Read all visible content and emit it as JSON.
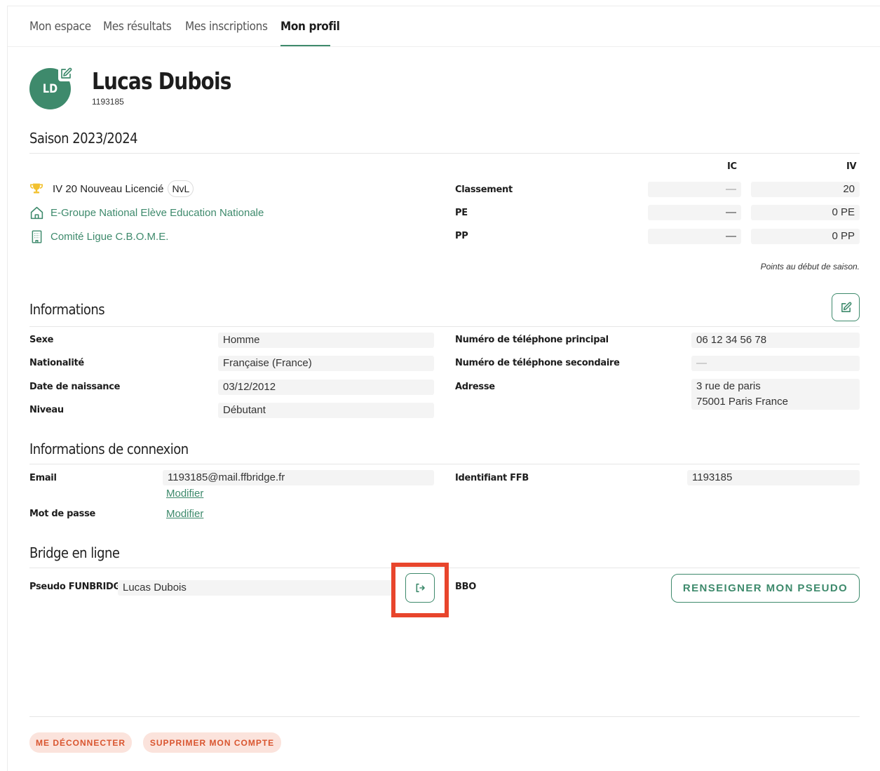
{
  "nav": {
    "tabs": [
      {
        "label": "Mon espace"
      },
      {
        "label": "Mes résultats"
      },
      {
        "label": "Mes inscriptions"
      },
      {
        "label": "Mon profil"
      }
    ]
  },
  "profile": {
    "initials": "LD",
    "name": "Lucas Dubois",
    "license_number": "1193185",
    "avatar_color": "#3e8a6c"
  },
  "season": {
    "title": "Saison 2023/2024",
    "rank_text": "IV 20 Nouveau Licencié",
    "rank_badge": "NvL",
    "group": "E-Groupe National Elève Education Nationale",
    "committee": "Comité Ligue C.B.O.M.E.",
    "columns": [
      "IC",
      "IV"
    ],
    "rows": [
      {
        "label": "Classement",
        "ic": "—",
        "iv": "20"
      },
      {
        "label": "PE",
        "ic": "—",
        "iv": "0 PE"
      },
      {
        "label": "PP",
        "ic": "—",
        "iv": "0 PP"
      }
    ],
    "note": "Points au début de saison."
  },
  "informations": {
    "title": "Informations",
    "left": [
      {
        "label": "Sexe",
        "value": "Homme"
      },
      {
        "label": "Nationalité",
        "value": "Française (France)"
      },
      {
        "label": "Date de naissance",
        "value": "03/12/2012"
      },
      {
        "label": "Niveau",
        "value": "Débutant"
      }
    ],
    "right": [
      {
        "label": "Numéro de téléphone principal",
        "value": "06 12 34 56 78"
      },
      {
        "label": "Numéro de téléphone secondaire",
        "value": "—"
      },
      {
        "label": "Adresse",
        "value_line1": "3 rue de paris",
        "value_line2": "75001 Paris France"
      }
    ]
  },
  "connexion": {
    "title": "Informations de connexion",
    "email_label": "Email",
    "email_value": "1193185@mail.ffbridge.fr",
    "email_modify": "Modifier",
    "password_label": "Mot de passe",
    "password_modify": "Modifier",
    "ffb_label": "Identifiant FFB",
    "ffb_value": "1193185"
  },
  "bridge": {
    "title": "Bridge en ligne",
    "funbridge_label": "Pseudo FUNBRIDGE",
    "funbridge_value": "Lucas Dubois",
    "bbo_label": "BBO",
    "bbo_button": "RENSEIGNER MON PSEUDO"
  },
  "footer": {
    "logout": "ME DÉCONNECTER",
    "delete": "SUPPRIMER MON COMPTE"
  },
  "colors": {
    "accent": "#3e8a6c",
    "highlight": "#e8452c",
    "danger_text": "#d9552f",
    "danger_bg": "#fbe3dc"
  }
}
